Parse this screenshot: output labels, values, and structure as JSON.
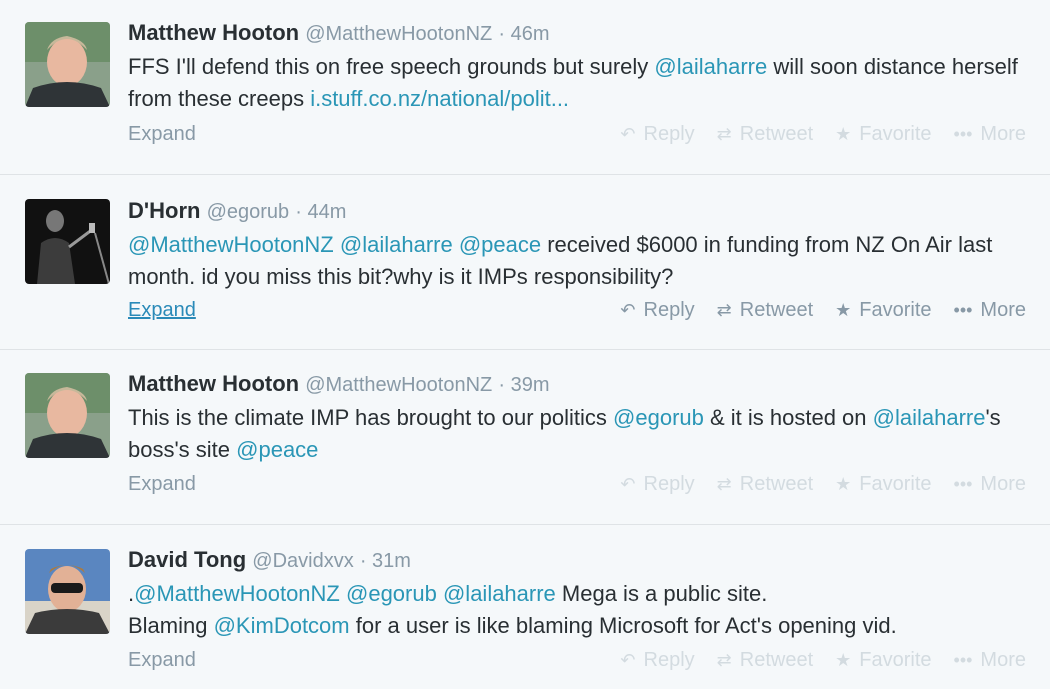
{
  "tweets": [
    {
      "name": "Matthew Hooton",
      "handle": "@MatthewHootonNZ",
      "time": "· 46m",
      "segments": [
        {
          "t": "FFS I'll defend this on free speech grounds but surely "
        },
        {
          "t": "@lailaharre",
          "k": "mention"
        },
        {
          "t": " will soon distance herself from these creeps "
        },
        {
          "t": "i.stuff.co.nz/national/polit...",
          "k": "link"
        }
      ],
      "expand": "Expand"
    },
    {
      "name": "D'Horn",
      "handle": "@egorub",
      "time": "· 44m",
      "segments": [
        {
          "t": "@MatthewHootonNZ",
          "k": "mention"
        },
        {
          "t": " "
        },
        {
          "t": "@lailaharre",
          "k": "mention"
        },
        {
          "t": " "
        },
        {
          "t": "@peace",
          "k": "mention"
        },
        {
          "t": " received $6000 in funding from NZ On Air last month. id you miss this bit?why is it IMPs responsibility?"
        }
      ],
      "expand": "Expand"
    },
    {
      "name": "Matthew Hooton",
      "handle": "@MatthewHootonNZ",
      "time": "· 39m",
      "segments": [
        {
          "t": "This is the climate IMP has brought to our politics "
        },
        {
          "t": "@egorub",
          "k": "mention"
        },
        {
          "t": " & it is hosted on "
        },
        {
          "t": "@lailaharre",
          "k": "mention"
        },
        {
          "t": "'s boss's site "
        },
        {
          "t": "@peace",
          "k": "mention"
        }
      ],
      "expand": "Expand"
    },
    {
      "name": "David Tong",
      "handle": "@Davidxvx",
      "time": "· 31m",
      "segments": [
        {
          "t": "."
        },
        {
          "t": "@MatthewHootonNZ",
          "k": "mention"
        },
        {
          "t": " "
        },
        {
          "t": "@egorub",
          "k": "mention"
        },
        {
          "t": " "
        },
        {
          "t": "@lailaharre",
          "k": "mention"
        },
        {
          "t": " Mega is a public site.\nBlaming "
        },
        {
          "t": "@KimDotcom",
          "k": "mention"
        },
        {
          "t": " for a user is like blaming Microsoft for Act's opening vid."
        }
      ],
      "expand": "Expand"
    }
  ],
  "actions": {
    "reply": "Reply",
    "retweet": "Retweet",
    "favorite": "Favorite",
    "more": "More"
  },
  "icons": {
    "reply": "reply-arrow-icon",
    "retweet": "retweet-icon",
    "favorite": "star-icon",
    "more": "ellipsis-icon"
  },
  "colors": {
    "link": "#2a96b6",
    "meta": "#8899a6",
    "background": "#f5f8fa"
  }
}
